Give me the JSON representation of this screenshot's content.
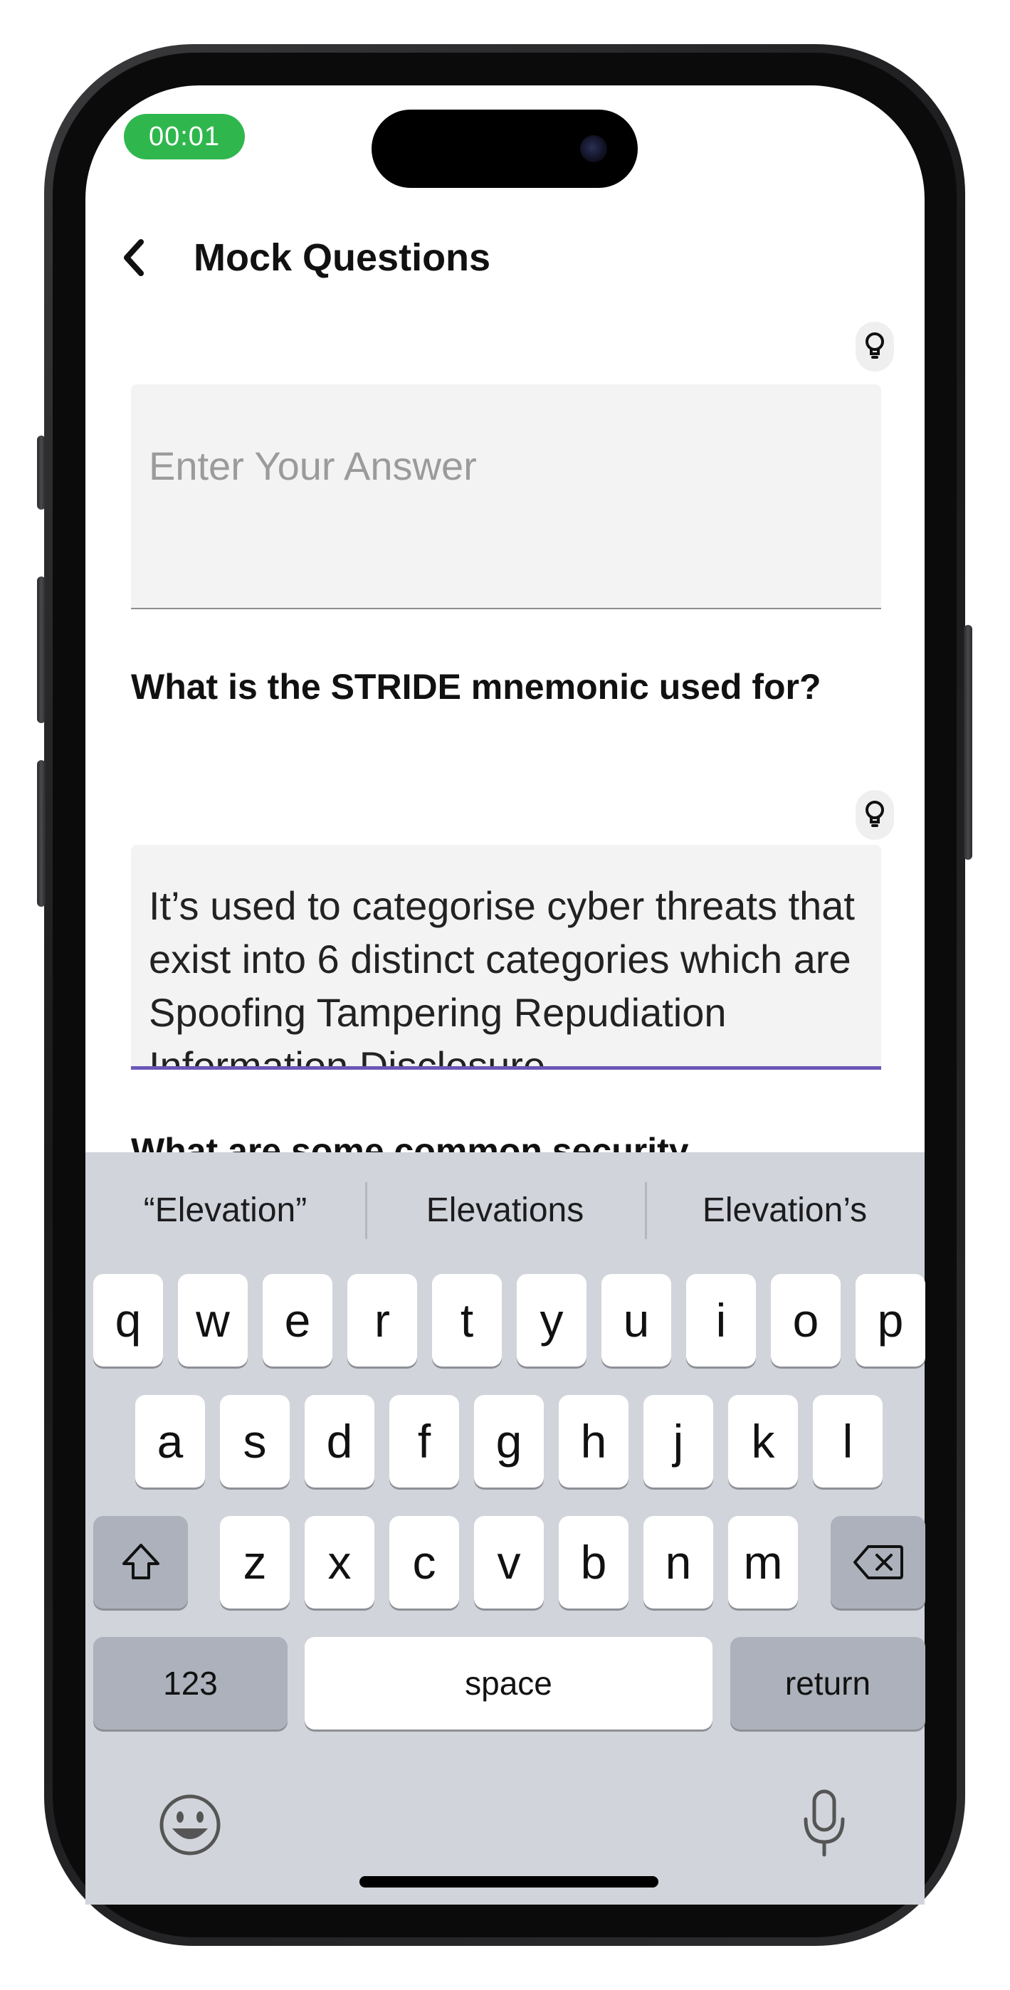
{
  "status_bar": {
    "timer": "00:01"
  },
  "header": {
    "title": "Mock Questions",
    "back_icon": "chevron-left-icon"
  },
  "form": {
    "hint_icon": "lightbulb-icon",
    "answer1_placeholder": "Enter Your Answer",
    "question2": "What is the STRIDE mnemonic used for?",
    "answer2_value": "It’s used to categorise cyber threats that exist into 6 distinct categories which are Spoofing Tampering Repudiation Information Disclosure",
    "question3": "What are some common security"
  },
  "keyboard": {
    "suggestions": [
      "“Elevation”",
      "Elevations",
      "Elevation’s"
    ],
    "row1": [
      "q",
      "w",
      "e",
      "r",
      "t",
      "y",
      "u",
      "i",
      "o",
      "p"
    ],
    "row2": [
      "a",
      "s",
      "d",
      "f",
      "g",
      "h",
      "j",
      "k",
      "l"
    ],
    "row3": [
      "z",
      "x",
      "c",
      "v",
      "b",
      "n",
      "m"
    ],
    "numbers_label": "123",
    "space_label": "space",
    "return_label": "return",
    "shift_icon": "shift-icon",
    "delete_icon": "delete-icon",
    "emoji_icon": "emoji-icon",
    "mic_icon": "microphone-icon"
  },
  "colors": {
    "timer_green": "#2fb74d",
    "focus_underline": "#6b58b8",
    "keyboard_bg": "#d1d4da"
  }
}
